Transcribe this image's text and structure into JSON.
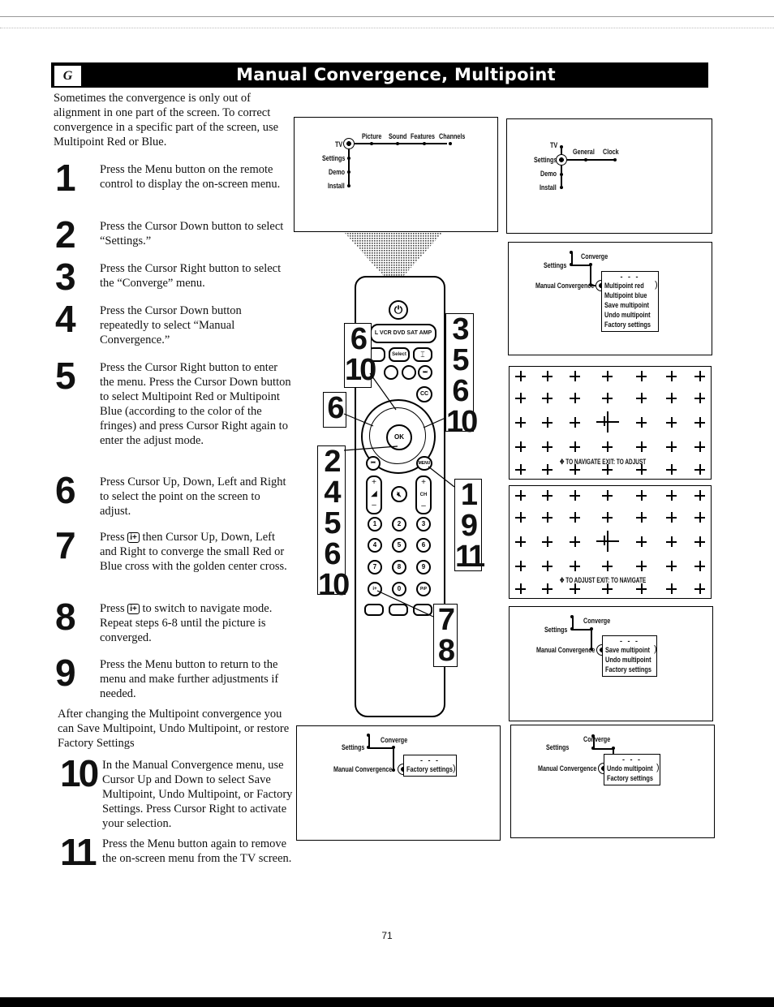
{
  "header": {
    "section_letter": "G",
    "title": "Manual Convergence, Multipoint"
  },
  "intro": "Sometimes the convergence is only out of alignment in one part of the screen.  To correct convergence in a specific part of the screen, use Multipoint Red or Blue.",
  "steps": [
    {
      "num": "1",
      "text": "Press the Menu button on the remote control to display the on-screen menu."
    },
    {
      "num": "2",
      "text": "Press the Cursor Down button to select “Settings.”"
    },
    {
      "num": "3",
      "text": "Press the Cursor Right button to select the “Converge” menu."
    },
    {
      "num": "4",
      "text": "Press the Cursor Down button repeatedly to select “Manual Convergence.”"
    },
    {
      "num": "5",
      "text": "Press the Cursor Right button to enter the menu.  Press the Cursor Down button to select Multipoint Red or Multipoint Blue (according to the color of the fringes) and press Cursor Right again to enter the adjust mode."
    },
    {
      "num": "6",
      "text": "Press Cursor Up, Down, Left and Right to select the point on the screen to adjust."
    },
    {
      "num": "7",
      "text_before": "Press",
      "icon": "i+",
      "text_after": "then Cursor Up, Down, Left and Right to converge the small Red or Blue cross with the golden center cross."
    },
    {
      "num": "8",
      "text_before": "Press",
      "icon": "i+",
      "text_after": "to switch to navigate mode.  Repeat steps 6-8 until the picture is converged."
    },
    {
      "num": "9",
      "text": "Press the Menu button to return to the menu and make further adjustments if needed."
    },
    {
      "num": "10",
      "text": "In the Manual Convergence menu, use Cursor Up and Down to select Save Multipoint, Undo Multipoint, or Factory Settings.  Press Cursor Right to activate your selection."
    },
    {
      "num": "11",
      "text": "Press the Menu button again to remove the on-screen menu from the TV screen."
    }
  ],
  "after_text": "After changing the Multipoint convergence you can Save Multipoint, Undo Multipoint, or restore Factory Settings",
  "screens": {
    "tv_menu": {
      "root": "TV",
      "top_items": [
        "Picture",
        "Sound",
        "Features",
        "Channels"
      ],
      "side_items": [
        "Settings",
        "Demo",
        "Install"
      ]
    },
    "settings_menu": {
      "side_items": [
        "TV",
        "Settings",
        "Demo",
        "Install"
      ],
      "top_items": [
        "General",
        "Clock"
      ]
    },
    "converge_menu_1": {
      "parent": "Settings",
      "branch": "Converge",
      "item": "Manual Convergence",
      "submenu": [
        "- - -",
        "Multipoint red",
        "Multipoint blue",
        "Save multipoint",
        "Undo multipoint",
        "Factory settings"
      ]
    },
    "grid_navigate": {
      "hint": "TO NAVIGATE  EXIT: TO ADJUST"
    },
    "grid_adjust": {
      "hint": "TO ADJUST  EXIT: TO NAVIGATE"
    },
    "converge_menu_2": {
      "parent": "Settings",
      "branch": "Converge",
      "item": "Manual Convergence",
      "submenu": [
        "- - -",
        "Save multipoint",
        "Undo multipoint",
        "Factory settings"
      ]
    },
    "converge_menu_3": {
      "parent": "Settings",
      "branch": "Converge",
      "item": "Manual Convergence",
      "submenu": [
        "- - -",
        "Factory settings"
      ]
    },
    "converge_menu_4": {
      "parent": "Settings",
      "branch": "Converge",
      "item": "Manual Convergence",
      "submenu": [
        "- - -",
        "Undo multipoint",
        "Factory settings"
      ]
    }
  },
  "remote": {
    "source_strip": "L  VCR  DVD  SAT  AMP",
    "select_label": "Select",
    "ok_label": "OK",
    "cc_label": "CC",
    "ch_label": "CH",
    "menu_label": "MENU",
    "pip_label": "PiP",
    "digits": [
      "1",
      "2",
      "3",
      "4",
      "5",
      "6",
      "7",
      "8",
      "9",
      "0"
    ],
    "callouts": {
      "top_left": [
        "6",
        "10"
      ],
      "right_top": [
        "3",
        "5",
        "6",
        "10"
      ],
      "mid_left": [
        "6"
      ],
      "left_lower": [
        "2",
        "4",
        "5",
        "6",
        "10"
      ],
      "right_lower": [
        "1",
        "9",
        "11"
      ],
      "bottom_right": [
        "7",
        "8"
      ]
    }
  },
  "page_number": "71"
}
